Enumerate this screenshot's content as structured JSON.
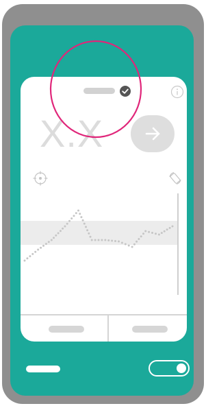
{
  "display": {
    "value": "X.X"
  },
  "icons": {
    "check": "check-circle-icon",
    "info": "info-icon",
    "go": "arrow-right-icon",
    "target": "crosshair-icon",
    "rotate": "rotate-phone-icon"
  },
  "chart": {
    "values": [
      0.12,
      0.28,
      0.42,
      0.62,
      0.85,
      0.42,
      0.42,
      0.4,
      0.32,
      0.55,
      0.5,
      0.62
    ],
    "band": [
      0.35,
      0.7
    ]
  },
  "toggle": {
    "state": true
  },
  "colors": {
    "phone_shell": "#8f8f8f",
    "screen": "#1ba99a",
    "card": "#ffffff",
    "placeholder": "#d6d6d6",
    "chart_band": "#ececec",
    "dots": "#c6c6c6",
    "highlight": "#e0267a"
  }
}
